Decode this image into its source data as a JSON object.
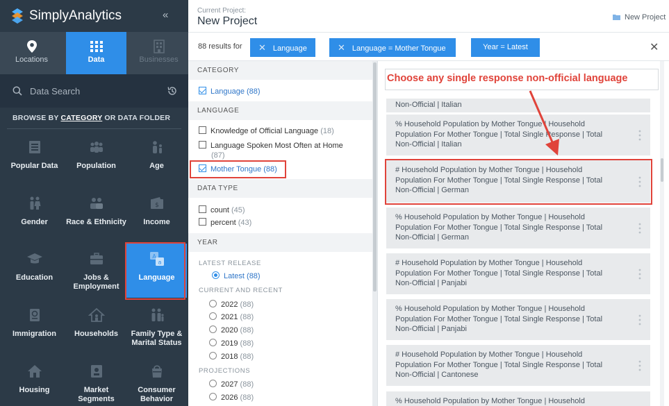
{
  "app": {
    "name": "SimplyAnalytics",
    "collapse_glyph": "«"
  },
  "nav_tabs": [
    {
      "label": "Locations",
      "icon": "map-pin-icon"
    },
    {
      "label": "Data",
      "icon": "grid-icon",
      "active": true
    },
    {
      "label": "Businesses",
      "icon": "building-icon",
      "disabled": true
    }
  ],
  "search": {
    "placeholder": "Data Search",
    "history_icon": "history-icon"
  },
  "browse": {
    "prefix": "BROWSE BY ",
    "category": "CATEGORY",
    "middle": " OR ",
    "folder": "DATA FOLDER"
  },
  "categories": [
    {
      "label": "Popular Data",
      "icon": "database-icon"
    },
    {
      "label": "Population",
      "icon": "people-group-icon"
    },
    {
      "label": "Age",
      "icon": "age-icon"
    },
    {
      "label": "Gender",
      "icon": "gender-icon"
    },
    {
      "label": "Race & Ethnicity",
      "icon": "race-icon"
    },
    {
      "label": "Income",
      "icon": "wallet-icon"
    },
    {
      "label": "Education",
      "icon": "graduation-cap-icon"
    },
    {
      "label": "Jobs &",
      "label2": "Employment",
      "icon": "briefcase-icon"
    },
    {
      "label": "Language",
      "icon": "language-icon",
      "selected": true
    },
    {
      "label": "Immigration",
      "icon": "passport-icon"
    },
    {
      "label": "Households",
      "icon": "household-icon"
    },
    {
      "label": "Family Type &",
      "label2": "Marital Status",
      "icon": "family-icon"
    },
    {
      "label": "Housing",
      "icon": "house-icon"
    },
    {
      "label": "Market",
      "label2": "Segments",
      "icon": "segments-icon"
    },
    {
      "label": "Consumer",
      "label2": "Behavior",
      "icon": "shopping-icon"
    }
  ],
  "header": {
    "caption": "Current Project:",
    "title": "New Project",
    "new_project_label": "New Project"
  },
  "filter_bar": {
    "results": "88 results for",
    "chips": [
      {
        "label": "Language"
      },
      {
        "label": "Language = Mother Tongue"
      },
      {
        "label": "Year = Latest"
      }
    ],
    "close_glyph": "✕"
  },
  "filters": {
    "category": {
      "heading": "CATEGORY",
      "options": [
        {
          "label": "Language",
          "count": "(88)",
          "checked": true
        }
      ]
    },
    "language": {
      "heading": "LANGUAGE",
      "options": [
        {
          "label": "Knowledge of Official Language",
          "count": "(18)"
        },
        {
          "label": "Language Spoken Most Often at Home",
          "count": "(87)"
        },
        {
          "label": "Mother Tongue",
          "count": "(88)",
          "checked": true
        }
      ]
    },
    "data_type": {
      "heading": "DATA TYPE",
      "options": [
        {
          "label": "count",
          "count": "(45)"
        },
        {
          "label": "percent",
          "count": "(43)"
        }
      ]
    },
    "year": {
      "heading": "YEAR",
      "latest_heading": "LATEST RELEASE",
      "latest": {
        "label": "Latest",
        "count": "(88)",
        "checked": true
      },
      "current_heading": "CURRENT AND RECENT",
      "current": [
        {
          "label": "2022",
          "count": "(88)"
        },
        {
          "label": "2021",
          "count": "(88)"
        },
        {
          "label": "2020",
          "count": "(88)"
        },
        {
          "label": "2019",
          "count": "(88)"
        },
        {
          "label": "2018",
          "count": "(88)"
        }
      ],
      "projections_heading": "PROJECTIONS",
      "projections": [
        {
          "label": "2027",
          "count": "(88)"
        },
        {
          "label": "2026",
          "count": "(88)"
        }
      ]
    }
  },
  "annotation": {
    "callout": "Choose any single response non-official language",
    "color": "#e0433a"
  },
  "results": {
    "partial_top": "Non-Official | Italian",
    "items": [
      {
        "line1": "% Household Population by Mother Tongue | Household",
        "line2": "Population For Mother Tongue | Total Single Response | Total",
        "line3": "Non-Official | Italian"
      },
      {
        "line1": "# Household Population by Mother Tongue | Household",
        "line2": "Population For Mother Tongue | Total Single Response | Total",
        "line3": "Non-Official | German",
        "highlighted": true
      },
      {
        "line1": "% Household Population by Mother Tongue | Household",
        "line2": "Population For Mother Tongue | Total Single Response | Total",
        "line3": "Non-Official | German"
      },
      {
        "line1": "# Household Population by Mother Tongue | Household",
        "line2": "Population For Mother Tongue | Total Single Response | Total",
        "line3": "Non-Official | Panjabi"
      },
      {
        "line1": "% Household Population by Mother Tongue | Household",
        "line2": "Population For Mother Tongue | Total Single Response | Total",
        "line3": "Non-Official | Panjabi"
      },
      {
        "line1": "# Household Population by Mother Tongue | Household",
        "line2": "Population For Mother Tongue | Total Single Response | Total",
        "line3": "Non-Official | Cantonese"
      },
      {
        "line1": "% Household Population by Mother Tongue | Household",
        "line2": "",
        "line3": ""
      }
    ]
  },
  "colors": {
    "sidebar_bg": "#2c3a47",
    "accent": "#2f8ee8",
    "highlight": "#e0433a"
  }
}
